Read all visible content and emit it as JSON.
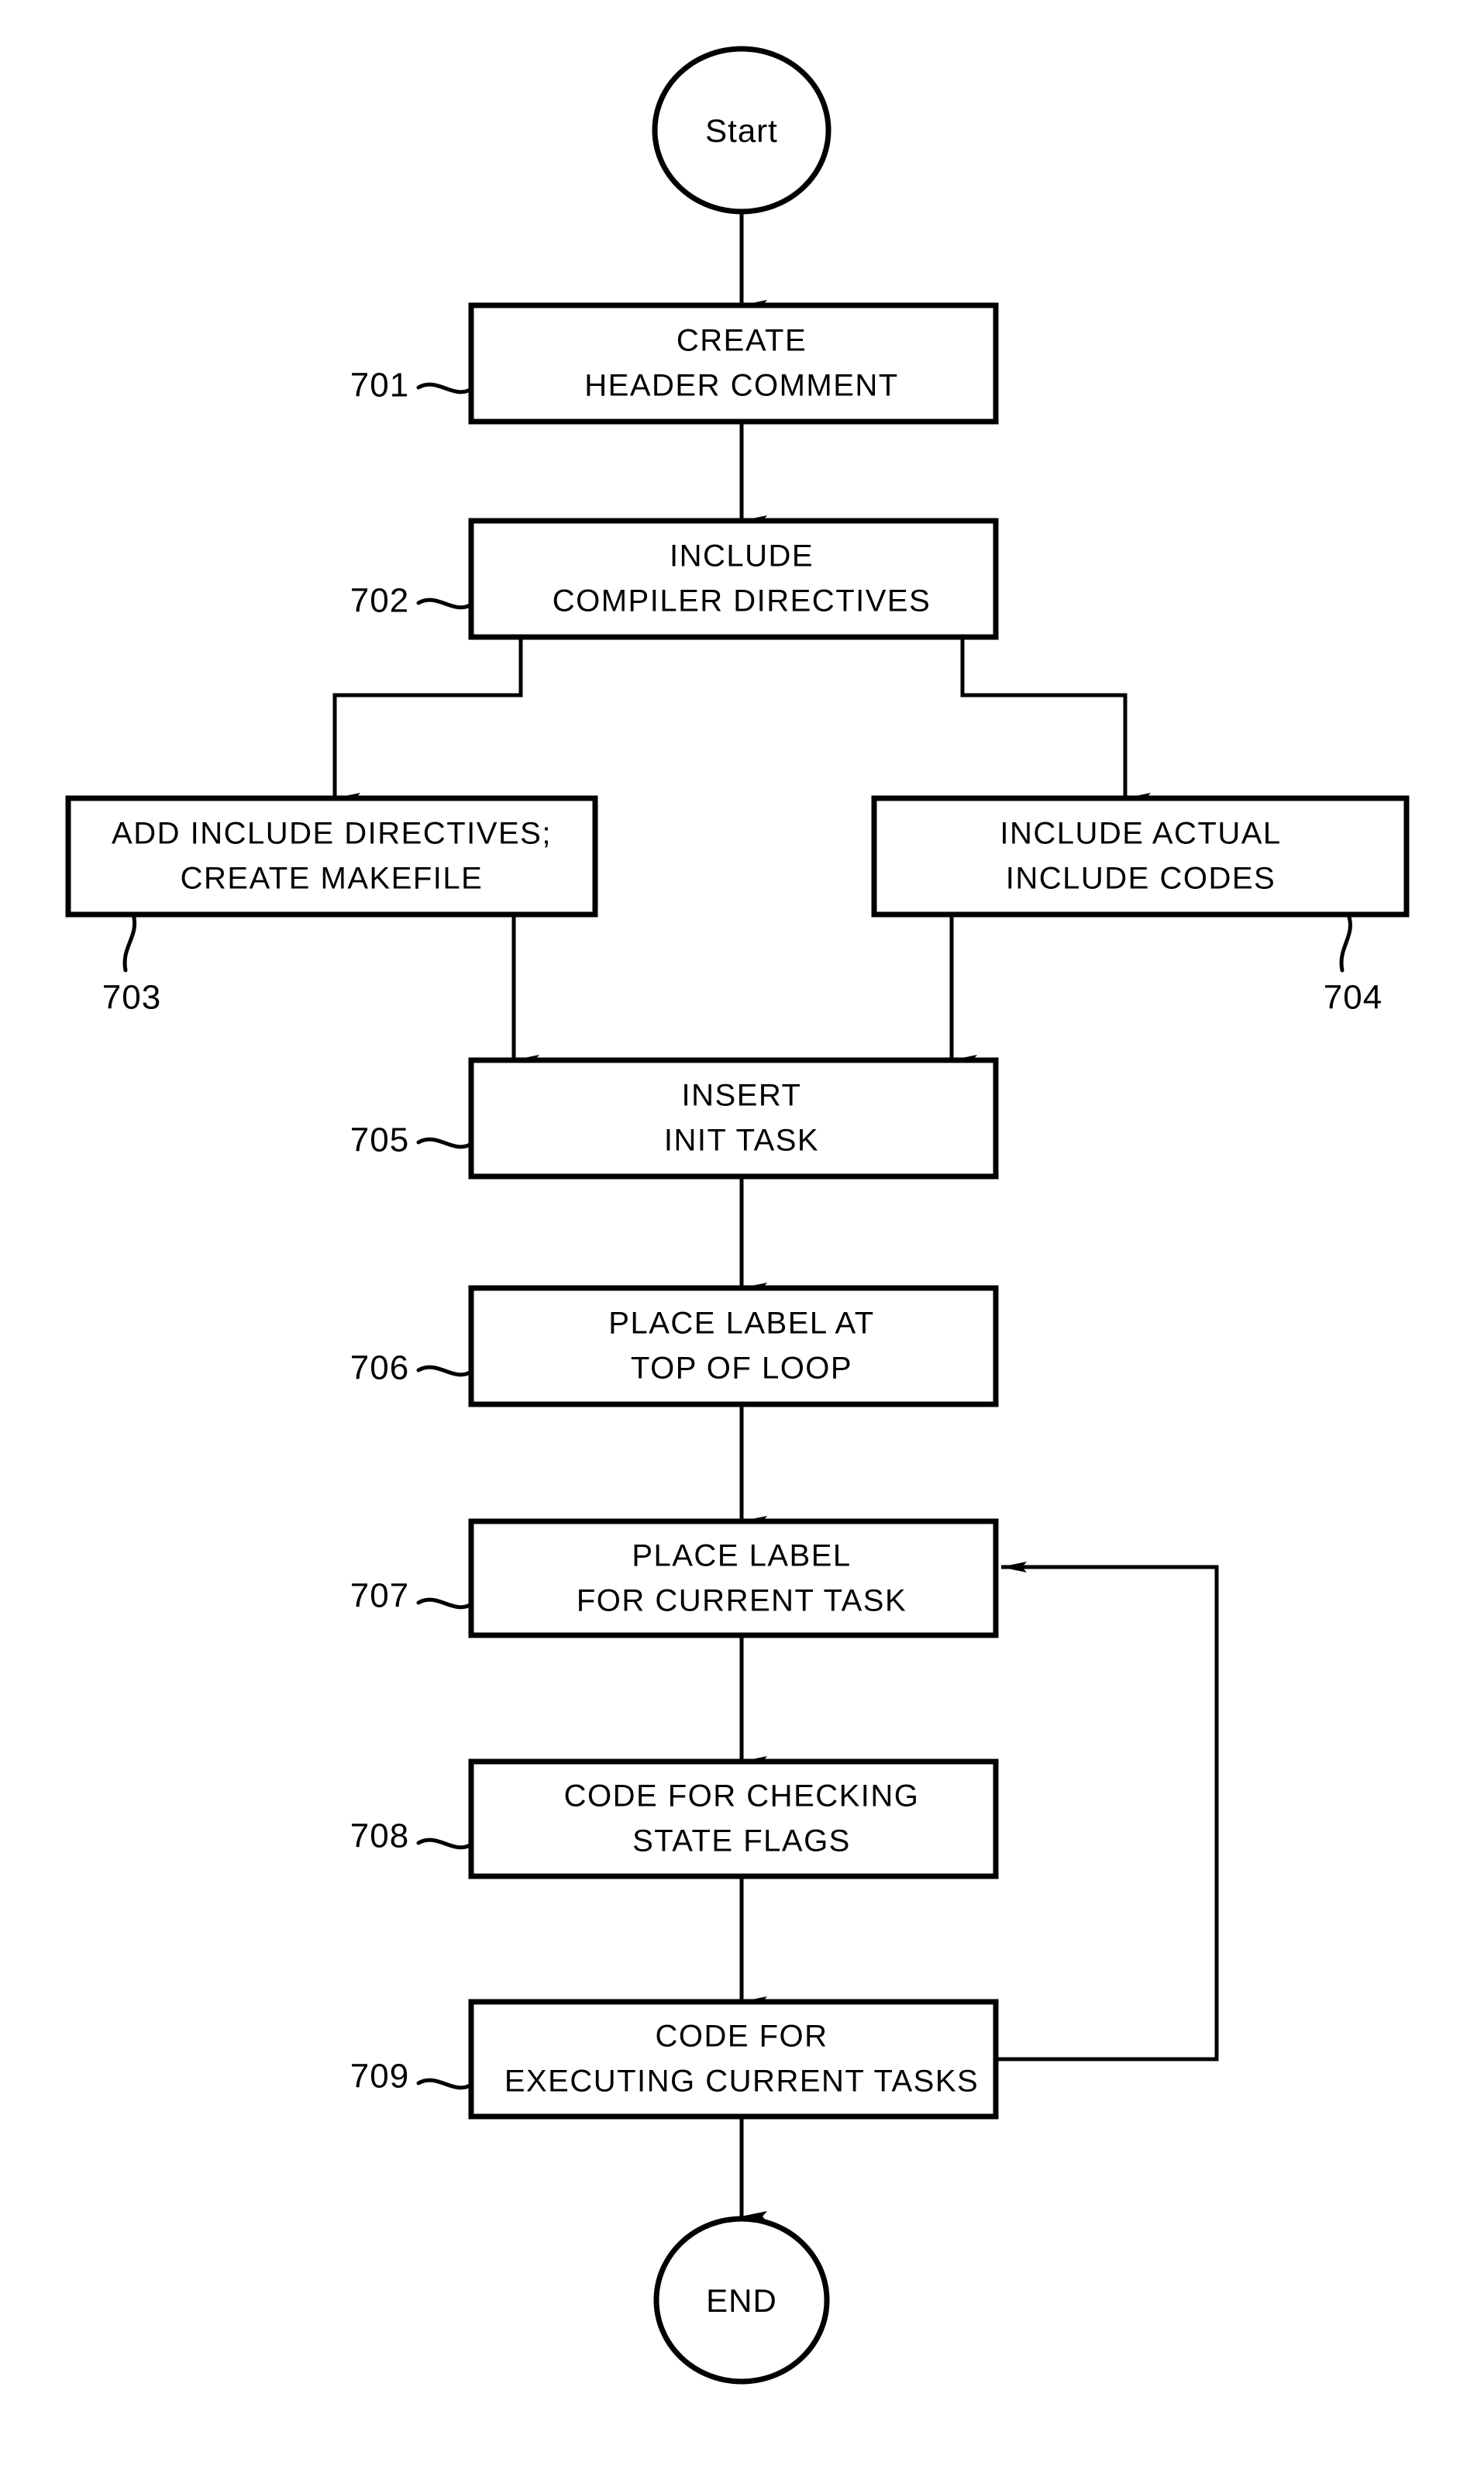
{
  "figure": {
    "type": "flowchart",
    "orientation": "vertical",
    "background_color": "#ffffff",
    "line_color": "#000000"
  },
  "terminals": {
    "start": {
      "label": "Start",
      "ref": ""
    },
    "end": {
      "label": "END",
      "ref": ""
    }
  },
  "steps": [
    {
      "ref": "701",
      "line1": "CREATE",
      "line2": "HEADER COMMENT"
    },
    {
      "ref": "702",
      "line1": "INCLUDE",
      "line2": "COMPILER DIRECTIVES"
    },
    {
      "ref": "703",
      "line1": "ADD INCLUDE DIRECTIVES;",
      "line2": "CREATE MAKEFILE"
    },
    {
      "ref": "704",
      "line1": "INCLUDE ACTUAL",
      "line2": "INCLUDE CODES"
    },
    {
      "ref": "705",
      "line1": "INSERT",
      "line2": "INIT TASK"
    },
    {
      "ref": "706",
      "line1": "PLACE LABEL AT",
      "line2": "TOP OF LOOP"
    },
    {
      "ref": "707",
      "line1": "PLACE LABEL",
      "line2": "FOR CURRENT TASK"
    },
    {
      "ref": "708",
      "line1": "CODE FOR CHECKING",
      "line2": "STATE FLAGS"
    },
    {
      "ref": "709",
      "line1": "CODE FOR",
      "line2": "EXECUTING CURRENT TASKS"
    }
  ],
  "flow": {
    "edges": [
      {
        "from": "start",
        "to": "701",
        "kind": "arrow-down"
      },
      {
        "from": "701",
        "to": "702",
        "kind": "arrow-down"
      },
      {
        "from": "702",
        "to": "703",
        "kind": "branch-left-down"
      },
      {
        "from": "702",
        "to": "704",
        "kind": "branch-right-down"
      },
      {
        "from": "703",
        "to": "705",
        "kind": "merge-down"
      },
      {
        "from": "704",
        "to": "705",
        "kind": "merge-down"
      },
      {
        "from": "705",
        "to": "706",
        "kind": "arrow-down"
      },
      {
        "from": "706",
        "to": "707",
        "kind": "arrow-down"
      },
      {
        "from": "707",
        "to": "708",
        "kind": "arrow-down"
      },
      {
        "from": "708",
        "to": "709",
        "kind": "arrow-down"
      },
      {
        "from": "709",
        "to": "707",
        "kind": "feedback-loop-right"
      },
      {
        "from": "709",
        "to": "end",
        "kind": "arrow-down"
      }
    ]
  }
}
